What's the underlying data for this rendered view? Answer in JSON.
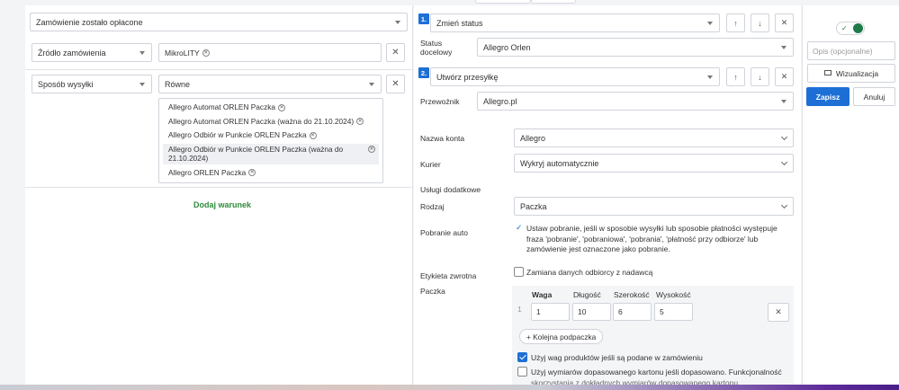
{
  "conditions": {
    "status_select": "Zamówienie zostało opłacone",
    "source_field": "Źródło zamówienia",
    "source_chip": "MikroLITY",
    "shipping_field": "Sposób wysyłki",
    "shipping_operator": "Równe",
    "shipping_values": [
      "Allegro Automat ORLEN Paczka",
      "Allegro Automat ORLEN Paczka (ważna do 21.10.2024)",
      "Allegro Odbiór w Punkcie ORLEN Paczka",
      "Allegro Odbiór w Punkcie ORLEN Paczka (ważna do 21.10.2024)",
      "Allegro ORLEN Paczka"
    ],
    "add_condition": "Dodaj warunek",
    "remove_symbol": "✕"
  },
  "actions": {
    "action1": {
      "number": "1.",
      "type": "Zmień status",
      "target_label": "Status docelowy",
      "target_value": "Allegro Orlen"
    },
    "action2": {
      "number": "2.",
      "type": "Utwórz przesyłkę",
      "carrier_label": "Przewoźnik",
      "carrier_value": "Allegro.pl",
      "account_label": "Nazwa konta",
      "account_value": "Allegro",
      "courier_label": "Kurier",
      "courier_value": "Wykryj automatycznie",
      "services_label": "Usługi dodatkowe",
      "type_label": "Rodzaj",
      "type_value": "Paczka",
      "cod_label": "Pobranie auto",
      "cod_text": "Ustaw pobranie, jeśli w sposobie wysyłki lub sposobie płatności występuje fraza 'pobranie', 'pobraniowa', 'pobrania', 'płatność przy odbiorze' lub zamówienie jest oznaczone jako pobranie.",
      "return_label": "Etykieta zwrotna",
      "return_text": "Zamiana danych odbiorcy z nadawcą",
      "package_label": "Paczka",
      "package_headers": [
        "Waga",
        "Długość",
        "Szerokość",
        "Wysokość"
      ],
      "package_row_index": "1",
      "package_values": [
        "1",
        "10",
        "6",
        "5"
      ],
      "add_subpackage": "+ Kolejna podpaczka",
      "use_weights_text": "Użyj wag produktów jeśli są podane w zamówieniu",
      "use_weights_checked": true,
      "use_dims_text": "Użyj wymiarów dopasowanego kartonu jeśli dopasowano. Funkcjonalność",
      "use_dims_text_cut": "skorzystania z dokładnych wymiarów dopasowanego kartonu",
      "use_dims_checked": false
    },
    "arrow_up": "↑",
    "arrow_down": "↓",
    "remove_symbol": "✕"
  },
  "side": {
    "toggle_on": true,
    "toggle_check": "✓",
    "description_placeholder": "Opis (opcjonalne)",
    "visualize_label": "Wizualizacja",
    "save_label": "Zapisz",
    "cancel_label": "Anuluj"
  },
  "colors": {
    "accent": "#1d6fd6",
    "add_condition_green": "#2e8b3c",
    "toggle_green": "#1f7a4a"
  }
}
